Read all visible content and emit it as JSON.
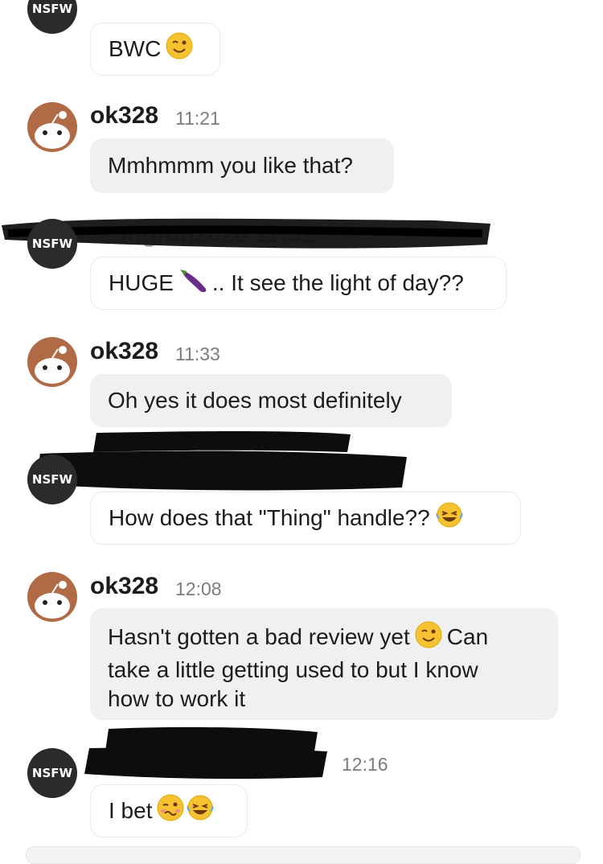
{
  "messages": [
    {
      "author": "",
      "time": "",
      "avatar": "NSFW",
      "text": "BWC",
      "emoji": "wink"
    },
    {
      "author": "ok328",
      "time": "11:21",
      "avatar": "snoo",
      "text": "Mmhmmm you like that?"
    },
    {
      "author": "",
      "time": "",
      "avatar": "NSFW",
      "text": "HUGE",
      "emoji": "eggplant",
      "text_after": ".. It see the light of day??"
    },
    {
      "author": "ok328",
      "time": "11:33",
      "avatar": "snoo",
      "text": "Oh yes it does most definitely"
    },
    {
      "author": "",
      "time": "",
      "avatar": "NSFW",
      "text": "How does that \"Thing\" handle??",
      "emoji": "laughing-tears"
    },
    {
      "author": "ok328",
      "time": "12:08",
      "avatar": "snoo",
      "text_lines": [
        "Hasn't gotten a bad review yet",
        "Can",
        "take a little getting used to but I know",
        "how to work it"
      ],
      "emoji": "wink"
    },
    {
      "author": "",
      "time": "12:16",
      "avatar": "NSFW",
      "text": "I bet",
      "emoji": [
        "woozy",
        "laughing-tears"
      ]
    }
  ],
  "composer": {
    "placeholder": ""
  },
  "colors": {
    "bubble_gray": "#f0f0f2",
    "avatar_nsfw": "#2b2b2b",
    "snoo_bg": "#b06a45"
  }
}
